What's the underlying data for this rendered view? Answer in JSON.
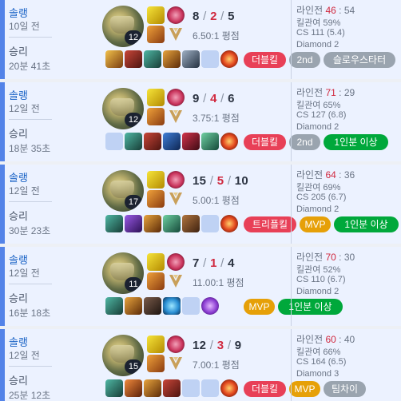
{
  "colors": {
    "win_border": "#5383e8",
    "card_bg": "#ecf2ff",
    "accent_red": "#d0293f",
    "tag_red": "#e84057",
    "tag_gray": "#9aa4af",
    "tag_orange": "#e6a008",
    "tag_green": "#00a83b"
  },
  "matches": [
    {
      "mode": "솔랭",
      "ago": "10일 전",
      "result": "승리",
      "duration": "20분 41초",
      "champion_level": "12",
      "kda": {
        "k": "8",
        "d": "2",
        "a": "5"
      },
      "kda_ratio": "6.50:1 평점",
      "items": [
        "item-gauntlet-icon",
        "item-armor-icon",
        "item-helm-icon",
        "item-sword-icon",
        "item-blade-icon",
        "item-empty",
        "ward-red-icon"
      ],
      "tags": [
        {
          "label": "더블킬",
          "color": "red"
        },
        {
          "label": "2nd",
          "color": "gray"
        },
        {
          "label": "슬로우스타터",
          "color": "gray"
        }
      ],
      "stats": {
        "lane_label": "라인전",
        "lane_a": "46",
        "lane_b": "54",
        "kill_part": "킬관여 59%",
        "cs": "CS 111 (5.4)",
        "tier": "Diamond 2"
      }
    },
    {
      "mode": "솔랭",
      "ago": "12일 전",
      "result": "승리",
      "duration": "18분 35초",
      "champion_level": "12",
      "kda": {
        "k": "9",
        "d": "4",
        "a": "6"
      },
      "kda_ratio": "3.75:1 평점",
      "items": [
        "item-empty",
        "item-helm-icon",
        "item-armor-icon",
        "item-blue-icon",
        "item-red-blade-icon",
        "item-green-icon",
        "ward-red-icon"
      ],
      "tags": [
        {
          "label": "더블킬",
          "color": "red"
        },
        {
          "label": "2nd",
          "color": "gray"
        },
        {
          "label": "1인분 이상",
          "color": "green"
        }
      ],
      "stats": {
        "lane_label": "라인전",
        "lane_a": "71",
        "lane_b": "29",
        "kill_part": "킬관여 65%",
        "cs": "CS 127 (6.8)",
        "tier": "Diamond 2"
      }
    },
    {
      "mode": "솔랭",
      "ago": "12일 전",
      "result": "승리",
      "duration": "30분 23초",
      "champion_level": "17",
      "kda": {
        "k": "15",
        "d": "5",
        "a": "10"
      },
      "kda_ratio": "5.00:1 평점",
      "items": [
        "item-helm-icon",
        "item-purple-icon",
        "item-sword-icon",
        "item-green-icon",
        "item-axe-icon",
        "item-empty",
        "ward-red-icon"
      ],
      "tags": [
        {
          "label": "트리플킬",
          "color": "red"
        },
        {
          "label": "MVP",
          "color": "orange"
        },
        {
          "label": "1인분 이상",
          "color": "green"
        }
      ],
      "stats": {
        "lane_label": "라인전",
        "lane_a": "64",
        "lane_b": "36",
        "kill_part": "킬관여 69%",
        "cs": "CS 205 (6.7)",
        "tier": "Diamond 2"
      }
    },
    {
      "mode": "솔랭",
      "ago": "12일 전",
      "result": "승리",
      "duration": "16분 18초",
      "champion_level": "11",
      "kda": {
        "k": "7",
        "d": "1",
        "a": "4"
      },
      "kda_ratio": "11.00:1 평점",
      "items": [
        "item-helm-icon",
        "item-sword-icon",
        "item-dark-icon",
        "item-blue-flame-icon",
        "item-empty",
        "ward-purple-icon"
      ],
      "tags": [
        {
          "label": "MVP",
          "color": "orange"
        },
        {
          "label": "1인분 이상",
          "color": "green"
        }
      ],
      "stats": {
        "lane_label": "라인전",
        "lane_a": "70",
        "lane_b": "30",
        "kill_part": "킬관여 52%",
        "cs": "CS 110 (6.7)",
        "tier": "Diamond 2"
      }
    },
    {
      "mode": "솔랭",
      "ago": "12일 전",
      "result": "승리",
      "duration": "25분 12초",
      "champion_level": "15",
      "kda": {
        "k": "12",
        "d": "3",
        "a": "9"
      },
      "kda_ratio": "7.00:1 평점",
      "items": [
        "item-helm-icon",
        "item-orange-icon",
        "item-sword-icon",
        "item-armor-icon",
        "item-empty",
        "item-empty",
        "ward-red-icon"
      ],
      "tags": [
        {
          "label": "더블킬",
          "color": "red"
        },
        {
          "label": "MVP",
          "color": "orange"
        },
        {
          "label": "팀차이",
          "color": "gray"
        }
      ],
      "stats": {
        "lane_label": "라인전",
        "lane_a": "60",
        "lane_b": "40",
        "kill_part": "킬관여 66%",
        "cs": "CS 164 (6.5)",
        "tier": "Diamond 3"
      }
    }
  ]
}
